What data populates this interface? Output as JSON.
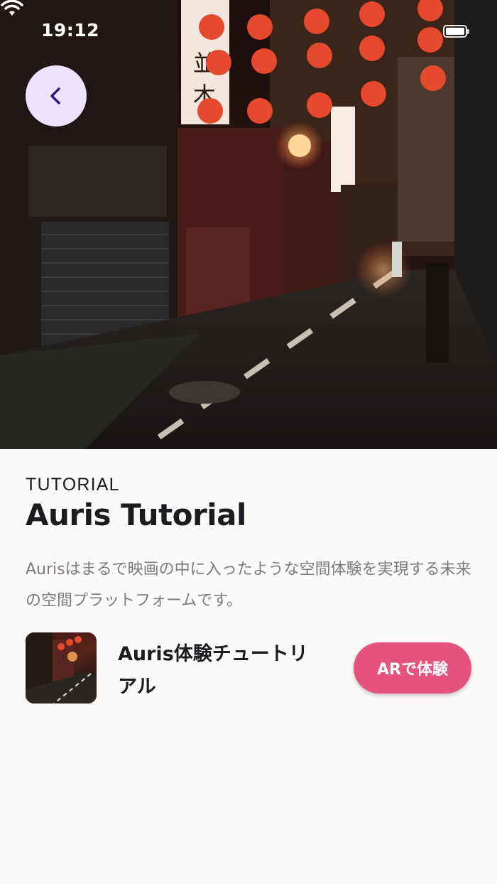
{
  "status_bar": {
    "time": "19:12",
    "wifi_icon": "wifi-icon",
    "battery_icon": "battery-icon"
  },
  "hero": {
    "back_icon": "chevron-left-icon",
    "image": "night-alley-lanterns-photo"
  },
  "content": {
    "eyebrow": "TUTORIAL",
    "title": "Auris Tutorial",
    "description": "Aurisはまるで映画の中に入ったような空間体験を実現する未来の空間プラットフォームです。"
  },
  "tutorial_item": {
    "title": "Auris体験チュートリアル",
    "button_label": "ARで体験"
  },
  "colors": {
    "background": "#fcf9f9",
    "back_button_bg": "#ece4ff",
    "back_icon": "#2b1a7a",
    "accent_button": "#e4527f",
    "text_primary": "#1c1b1f",
    "text_secondary": "#7c7a80"
  }
}
